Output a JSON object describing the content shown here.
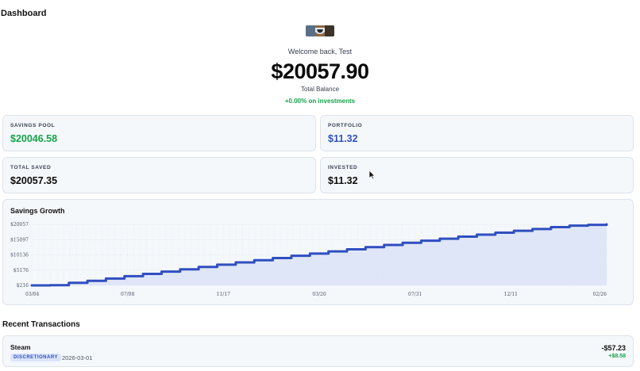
{
  "page": {
    "title": "Dashboard"
  },
  "hero": {
    "welcome": "Welcome back, Test",
    "balance": "$20057.90",
    "balance_label": "Total Balance",
    "gain": "+0.00% on investments"
  },
  "stats": [
    {
      "label": "SAVINGS POOL",
      "value": "$20046.58",
      "color": "#16a34a"
    },
    {
      "label": "PORTFOLIO",
      "value": "$11.32",
      "color": "#2f4fc0"
    },
    {
      "label": "TOTAL SAVED",
      "value": "$20057.35",
      "color": "#0b0b0b"
    },
    {
      "label": "INVESTED",
      "value": "$11.32",
      "color": "#0b0b0b"
    }
  ],
  "chart": {
    "title": "Savings Growth"
  },
  "chart_data": {
    "type": "area",
    "title": "Savings Growth",
    "xlabel": "",
    "ylabel": "",
    "x_ticks": [
      "03/04",
      "07/08",
      "11/17",
      "03/20",
      "07/31",
      "12/11",
      "02/26"
    ],
    "y_ticks": [
      "$216",
      "$5176",
      "$10136",
      "$15097",
      "$20057"
    ],
    "ylim": [
      216,
      20057
    ],
    "series": [
      {
        "values": [
          216,
          280,
          1050,
          1700,
          2450,
          3200,
          3950,
          4700,
          5450,
          6200,
          6950,
          7700,
          8400,
          9100,
          9850,
          10550,
          11250,
          11950,
          12650,
          13350,
          14050,
          14750,
          15400,
          16050,
          16700,
          17350,
          17950,
          18550,
          19150,
          19650,
          19900,
          20057
        ]
      }
    ],
    "color": "#2f4fc0",
    "fill": "#dbe3f7",
    "grid": true
  },
  "transactions_section": {
    "title": "Recent Transactions"
  },
  "transactions": [
    {
      "name": "Steam",
      "category": "DISCRETIONARY",
      "date": "2026-03-01",
      "amount": "-$57.23",
      "sub_amount": "+$8.58"
    }
  ],
  "icons": {
    "avatar": "avatar-image",
    "cursor": "mouse-cursor-icon"
  }
}
